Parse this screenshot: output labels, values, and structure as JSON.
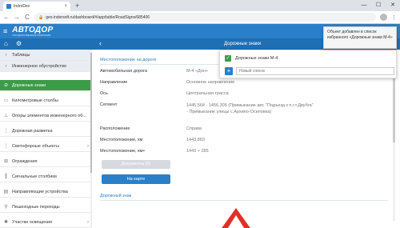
{
  "browser": {
    "tab_title": "IndorDev",
    "tab_close": "×",
    "new_tab": "+",
    "win_min": "—",
    "win_max": "☐",
    "win_close": "✕",
    "back": "←",
    "forward": "→",
    "reload": "C",
    "url": "geo.indorsoft.ru/dashboard/#/app/table/RoadSigns/685406",
    "menu": "⋮"
  },
  "app": {
    "logo_text": "АВТОДОР",
    "logo_sub": "ГОСУДАРСТВЕННАЯ КОМПАНИЯ",
    "page_title": "Дорожные знаки"
  },
  "sidebar": {
    "items": [
      {
        "label": "Таблицы",
        "icon": "chevron-left-icon",
        "glyph": "‹"
      },
      {
        "label": "Инженерное обустройство",
        "icon": "chevron-left-icon",
        "glyph": "‹"
      },
      {
        "label": "Дорожные знаки",
        "icon": "road-sign-icon",
        "glyph": "⊘"
      },
      {
        "label": "Километровые столбы",
        "icon": "km-post-icon",
        "glyph": "▭"
      },
      {
        "label": "Опоры элементов инженерного об...",
        "icon": "pole-icon",
        "glyph": "⊥"
      },
      {
        "label": "Дорожная разметка",
        "icon": "marking-icon",
        "glyph": "⋮"
      },
      {
        "label": "Светофорные объекты",
        "icon": "traffic-light-icon",
        "glyph": "⋮"
      },
      {
        "label": "Ограждения",
        "icon": "fence-icon",
        "glyph": "⊞"
      },
      {
        "label": "Сигнальные столбики",
        "icon": "signal-post-icon",
        "glyph": "┃"
      },
      {
        "label": "Направляющие устройства",
        "icon": "guide-icon",
        "glyph": "▤"
      },
      {
        "label": "Пешеходные переходы",
        "icon": "pedestrian-icon",
        "glyph": "⚲"
      },
      {
        "label": "Участки освещения",
        "icon": "lighting-icon",
        "glyph": "✱"
      }
    ],
    "chev": "›"
  },
  "main": {
    "section1": "Местоположение на дороге",
    "fields": [
      {
        "label": "Автомобильная дорога",
        "value": "М-4 «Дон»"
      },
      {
        "label": "Направление",
        "value": "Основное направление"
      },
      {
        "label": "Ось",
        "value": "Центральная трасса"
      },
      {
        "label": "Сегмент",
        "value": "1445,564 - 1456,305 (Примыкание авт. \"Подъезд к п.г.т.Двубга\" - Примыкание улицы с.Архипо-Осиповка)"
      },
      {
        "label": "Расположение",
        "value": "Справа"
      },
      {
        "label": "Местоположение, км",
        "value": "1443,863"
      },
      {
        "label": "Местоположение, км+",
        "value": "1443 + 285"
      }
    ],
    "documents_button": "Документы (0)",
    "map_button": "На карте",
    "section2": "Дорожный знак"
  },
  "popup": {
    "favorite_list": "Дорожные знаки М-4",
    "check_glyph": "✓",
    "plus_glyph": "+",
    "new_list_placeholder": "Новый список"
  },
  "toast": {
    "message": "Объект добавлен в список избранного «Дорожные знаки М-4»"
  },
  "colors": {
    "header_blue": "#2a7fc9",
    "subheader_blue": "#1f6fb5",
    "active_green": "#3b9c47",
    "sign_red": "#e03228"
  }
}
